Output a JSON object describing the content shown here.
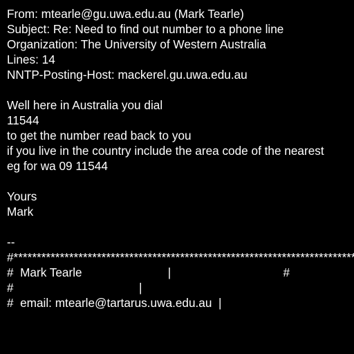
{
  "headers": {
    "from": "From: mtearle@gu.uwa.edu.au (Mark Tearle)",
    "subject": "Subject: Re: Need to find out number to a phone line",
    "organization": "Organization: The University of Western Australia",
    "lines": "Lines: 14",
    "posting_host": "NNTP-Posting-Host: mackerel.gu.uwa.edu.au"
  },
  "body": [
    "Well here in Australia you dial",
    "11544",
    "to get the number read back to you",
    "if you live in the country include the area code of the nearest",
    "eg for wa 09 11544"
  ],
  "closing": {
    "salutation": "Yours",
    "name": "Mark"
  },
  "signature": [
    "--",
    "#**************************************************************************",
    "#  Mark Tearle                          |                                  #",
    "#                                      |",
    "#  email: mtearle@tartarus.uwa.edu.au  |"
  ],
  "colors": {
    "background": "#000000",
    "text": "#ffffff"
  }
}
